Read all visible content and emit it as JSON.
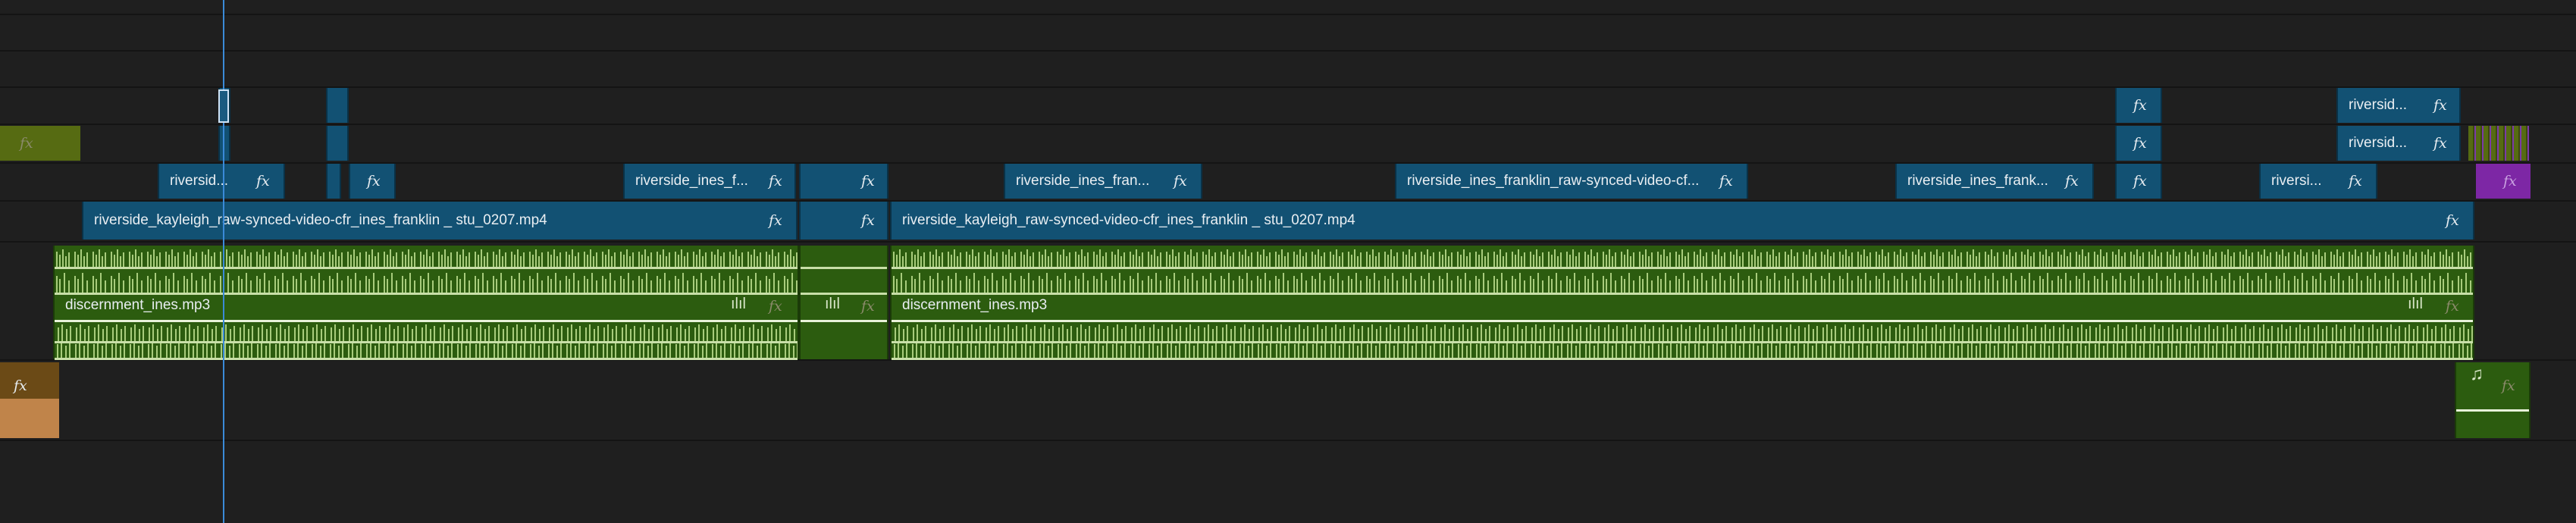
{
  "timeline": {
    "video_clips": [
      {
        "label": "riversid...",
        "fx": "fx"
      },
      {
        "label": "riverside_ines_f...",
        "fx": "fx"
      },
      {
        "label": "",
        "fx": "fx"
      },
      {
        "label": "riverside_ines_fran...",
        "fx": "fx"
      },
      {
        "label": "riverside_ines_franklin_raw-synced-video-cf...",
        "fx": "fx"
      },
      {
        "label": "riverside_ines_frank...",
        "fx": "fx"
      },
      {
        "label": "riversi...",
        "fx": "fx"
      },
      {
        "label": "riversid...",
        "fx": "fx"
      },
      {
        "label": "riversid...",
        "fx": "fx"
      },
      {
        "label": "riverside_kayleigh_raw-synced-video-cfr_ines_franklin _ stu_0207.mp4",
        "fx": "fx"
      },
      {
        "label": "riverside_kayleigh_raw-synced-video-cfr_ines_franklin _ stu_0207.mp4",
        "fx": "fx"
      }
    ],
    "audio_clips": [
      {
        "label": "discernment_ines.mp3"
      },
      {
        "label": "discernment_ines.mp3"
      }
    ],
    "fx_label": "fx",
    "music_icon": "♫",
    "waveform_icon": "waveform-icon"
  }
}
